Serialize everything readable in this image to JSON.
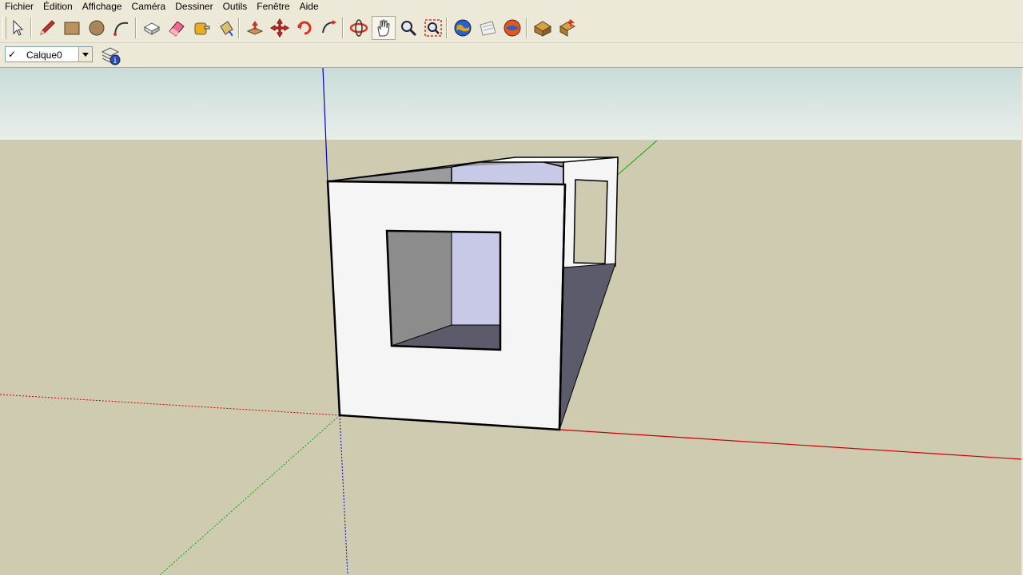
{
  "menubar": {
    "items": [
      "Fichier",
      "Édition",
      "Affichage",
      "Caméra",
      "Dessiner",
      "Outils",
      "Fenêtre",
      "Aide"
    ]
  },
  "toolbar": {
    "tools": [
      {
        "name": "select-tool",
        "icon": "arrow-cursor-icon"
      },
      {
        "name": "pencil-tool",
        "icon": "pencil-icon"
      },
      {
        "name": "rectangle-tool",
        "icon": "rectangle-icon"
      },
      {
        "name": "circle-tool",
        "icon": "circle-icon"
      },
      {
        "name": "arc-tool",
        "icon": "arc-icon"
      },
      {
        "name": "make-component-tool",
        "icon": "component-icon"
      },
      {
        "name": "eraser-tool",
        "icon": "eraser-icon"
      },
      {
        "name": "tape-measure-tool",
        "icon": "tape-measure-icon"
      },
      {
        "name": "paint-bucket-tool",
        "icon": "paint-bucket-icon"
      },
      {
        "name": "push-pull-tool",
        "icon": "push-pull-icon"
      },
      {
        "name": "move-tool",
        "icon": "move-icon"
      },
      {
        "name": "rotate-tool",
        "icon": "rotate-icon"
      },
      {
        "name": "follow-me-tool",
        "icon": "follow-me-icon"
      },
      {
        "name": "orbit-tool",
        "icon": "orbit-icon"
      },
      {
        "name": "pan-tool",
        "icon": "hand-icon"
      },
      {
        "name": "zoom-tool",
        "icon": "magnifier-icon"
      },
      {
        "name": "zoom-extents-tool",
        "icon": "zoom-extents-icon"
      },
      {
        "name": "google-earth-tool",
        "icon": "globe-icon"
      },
      {
        "name": "get-models-tool",
        "icon": "get-models-icon"
      },
      {
        "name": "share-model-tool",
        "icon": "share-model-icon"
      },
      {
        "name": "get-components-tool",
        "icon": "warehouse-icon"
      },
      {
        "name": "share-component-tool",
        "icon": "share-component-icon"
      }
    ],
    "active_tool": "pan-tool"
  },
  "layers": {
    "current_layer": "Calque0",
    "checked_symbol": "✓",
    "manager_icon": "layer-manager-icon"
  },
  "colors": {
    "sky": "#d6e6e4",
    "ground": "#cfcbb0",
    "wall_face": "#f5f5f5",
    "window_light": "#c8c9e6",
    "shadow_dark": "#5c5b6b",
    "axis_red": "#cc0000",
    "axis_green": "#00aa00",
    "axis_blue": "#0000cc"
  }
}
